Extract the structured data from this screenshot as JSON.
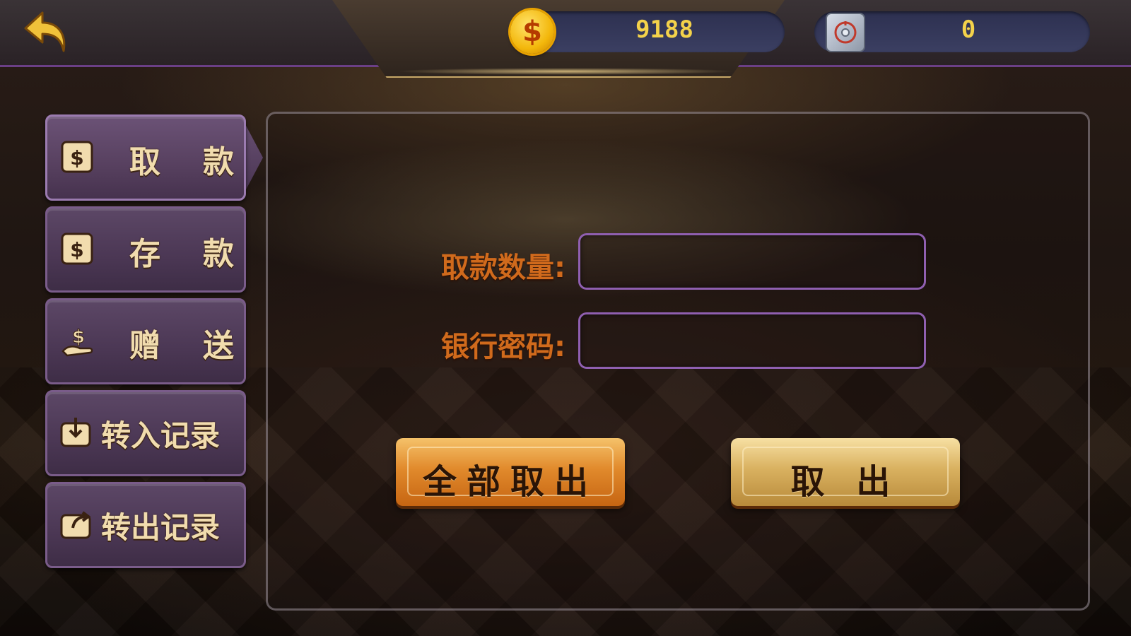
{
  "header": {
    "coin_balance": "9188",
    "safe_balance": "0"
  },
  "sidebar": {
    "items": [
      {
        "label_a": "取",
        "label_b": "款",
        "active": true
      },
      {
        "label_a": "存",
        "label_b": "款",
        "active": false
      },
      {
        "label_a": "赠",
        "label_b": "送",
        "active": false
      },
      {
        "label": "转入记录",
        "active": false
      },
      {
        "label": "转出记录",
        "active": false
      }
    ]
  },
  "form": {
    "amount_label": "取款数量:",
    "amount_value": "",
    "password_label": "银行密码:",
    "password_value": ""
  },
  "actions": {
    "withdraw_all_label": "全部取出",
    "withdraw_label": "取 出"
  },
  "colors": {
    "accent_purple": "#8f5fb0",
    "label_orange": "#d06a1c",
    "coin_gold": "#f4d24a"
  }
}
